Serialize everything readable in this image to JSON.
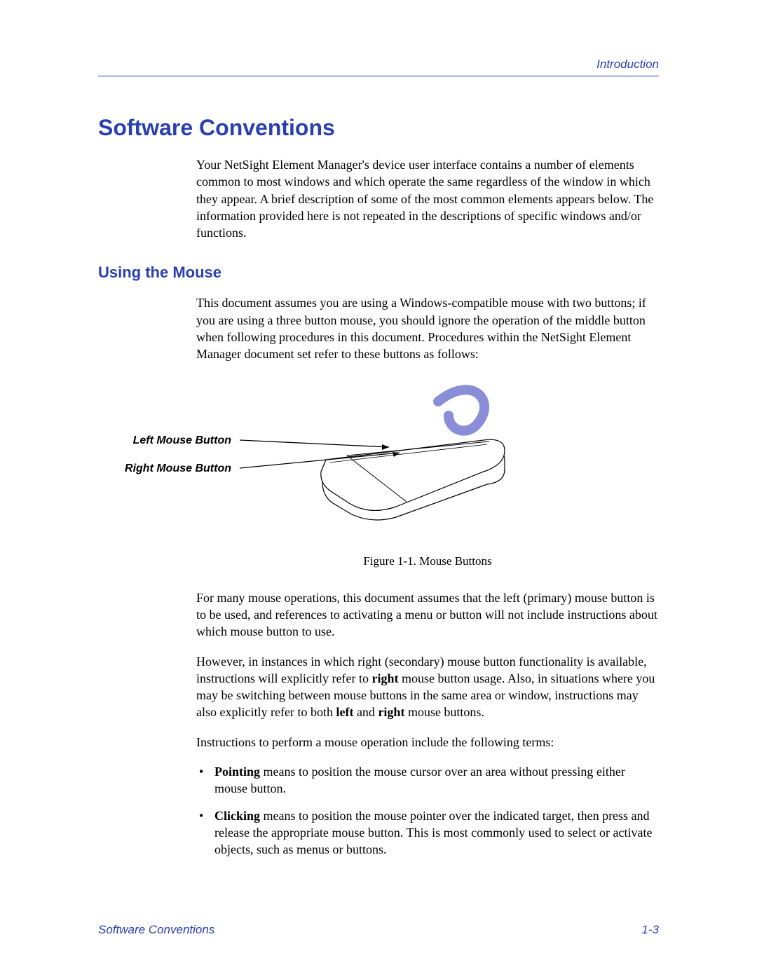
{
  "header": {
    "section": "Introduction"
  },
  "h1": "Software Conventions",
  "intro": "Your NetSight Element Manager's device user interface contains a number of elements common to most windows and which operate the same regardless of the window in which they appear. A brief description of some of the most common elements appears below. The information provided here is not repeated in the descriptions of specific windows and/or functions.",
  "h2": "Using the Mouse",
  "mouse_para": "This document assumes you are using a Windows-compatible mouse with two buttons; if you are using a three button mouse, you should ignore the operation of the middle button when following procedures in this document. Procedures within the NetSight Element Manager document set refer to these buttons as follows:",
  "figure": {
    "left_label": "Left Mouse Button",
    "right_label": "Right Mouse Button",
    "caption": "Figure 1-1.  Mouse Buttons"
  },
  "para_primary": "For many mouse operations, this document assumes that the left (primary) mouse button is to be used, and references to activating a menu or button will not include instructions about which mouse button to use.",
  "para_right": {
    "pre": "However, in instances in which right (secondary) mouse button functionality is available, instructions will explicitly refer to ",
    "b1": "right",
    "mid": " mouse button usage. Also, in situations where you may be switching between mouse buttons in the same area or window, instructions may also explicitly refer to both ",
    "b2": "left",
    "and": " and ",
    "b3": "right",
    "post": " mouse buttons."
  },
  "terms_intro": "Instructions to perform a mouse operation include the following terms:",
  "bullets": {
    "pointing": {
      "term": "Pointing",
      "rest": " means to position the mouse cursor over an area without pressing either mouse button."
    },
    "clicking": {
      "term": "Clicking",
      "rest": " means to position the mouse pointer over the indicated target, then press and release the appropriate mouse button. This is most commonly used to select or activate objects, such as menus or buttons."
    }
  },
  "footer": {
    "left": "Software Conventions",
    "right": "1-3"
  }
}
